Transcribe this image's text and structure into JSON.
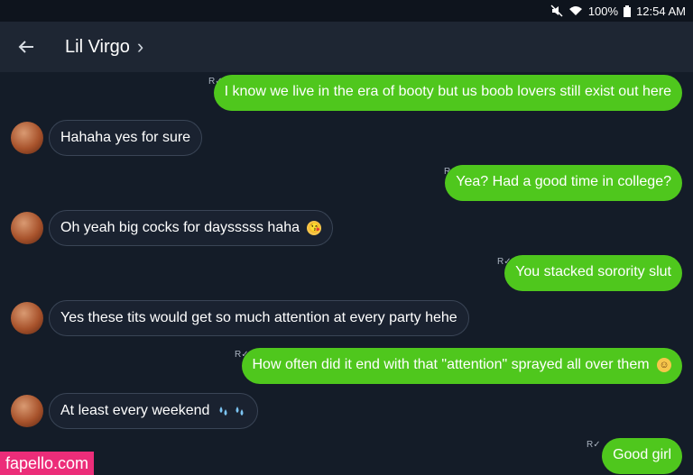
{
  "status_bar": {
    "battery": "100%",
    "time": "12:54 AM"
  },
  "header": {
    "contact_name": "Lil Virgo",
    "chevron": "›"
  },
  "messages": [
    {
      "side": "out",
      "text": "I know we live in the era of booty but us boob lovers still exist out here"
    },
    {
      "side": "in",
      "text": "Hahaha yes for sure"
    },
    {
      "side": "out",
      "text": "Yea? Had a good time in college?"
    },
    {
      "side": "in",
      "text": "Oh yeah big cocks for daysssss haha",
      "emoji": "kiss-emoji"
    },
    {
      "side": "out",
      "text": "You stacked sorority slut"
    },
    {
      "side": "in",
      "text": "Yes these tits would get so much attention at every party hehe"
    },
    {
      "side": "out",
      "text": "How often did it end with that \"attention\" sprayed all over them",
      "emoji": "smile-emoji"
    },
    {
      "side": "in",
      "text": "At least every weekend",
      "emoji": "sweat-droplets-emoji"
    },
    {
      "side": "out",
      "text": "Good girl"
    }
  ],
  "watermark": "fapello.com",
  "colors": {
    "background": "#141c28",
    "header": "#1e2633",
    "outgoing_bubble": "#4fc71d",
    "incoming_border": "#3a4556",
    "watermark_bg": "#ec2d79"
  }
}
